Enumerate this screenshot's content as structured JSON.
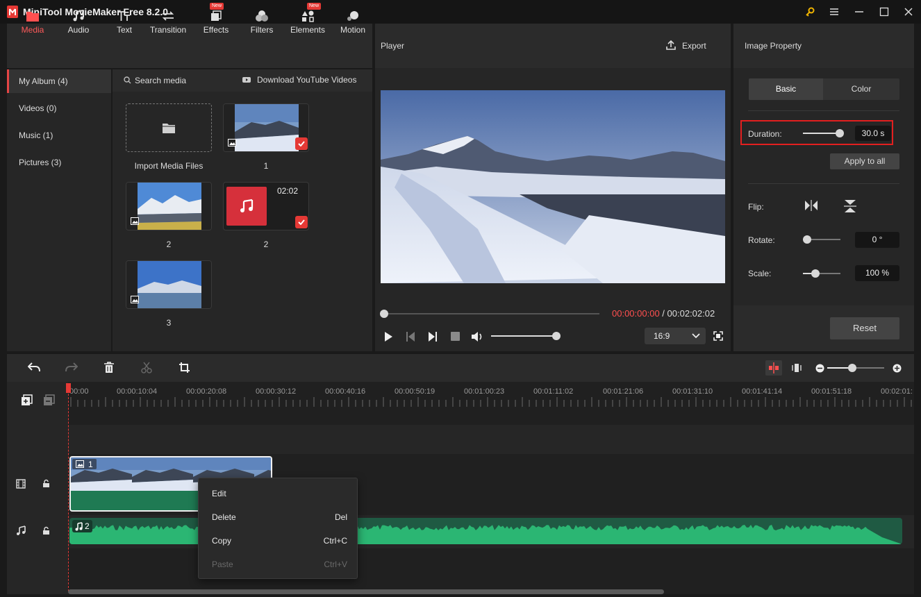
{
  "app": {
    "title": "MiniTool MovieMaker Free 8.2.0"
  },
  "toolbar": {
    "tabs": [
      {
        "label": "Media",
        "icon": "media-folder-icon",
        "active": true
      },
      {
        "label": "Audio",
        "icon": "music-note-icon"
      },
      {
        "label": "Text",
        "icon": "text-tt-icon"
      },
      {
        "label": "Transition",
        "icon": "transition-arrows-icon"
      },
      {
        "label": "Effects",
        "icon": "effects-icon",
        "badge": "New"
      },
      {
        "label": "Filters",
        "icon": "filters-icon"
      },
      {
        "label": "Elements",
        "icon": "elements-icon",
        "badge": "New"
      },
      {
        "label": "Motion",
        "icon": "motion-icon"
      }
    ]
  },
  "library": {
    "nav": [
      {
        "label": "My Album (4)",
        "active": true
      },
      {
        "label": "Videos (0)"
      },
      {
        "label": "Music (1)"
      },
      {
        "label": "Pictures (3)"
      }
    ],
    "search_label": "Search media",
    "download_label": "Download YouTube Videos",
    "items": [
      {
        "label": "Import Media Files"
      },
      {
        "label": "1"
      },
      {
        "label": "2"
      },
      {
        "label": "2",
        "duration": "02:02"
      },
      {
        "label": "3"
      }
    ]
  },
  "player": {
    "title": "Player",
    "export_label": "Export",
    "time_current": "00:00:00:00",
    "time_separator": " / ",
    "time_total": "00:02:02:02",
    "aspect_ratio": "16:9",
    "progress": 0,
    "volume": 1.0
  },
  "property": {
    "title": "Image Property",
    "tabs": [
      "Basic",
      "Color"
    ],
    "duration_label": "Duration:",
    "duration_value": "30.0 s",
    "apply_all_label": "Apply to all",
    "flip_label": "Flip:",
    "rotate_label": "Rotate:",
    "rotate_value": "0 °",
    "scale_label": "Scale:",
    "scale_value": "100 %",
    "reset_label": "Reset"
  },
  "timeline": {
    "ruler": [
      "00:00",
      "00:00:10:04",
      "00:00:20:08",
      "00:00:30:12",
      "00:00:40:16",
      "00:00:50:19",
      "00:01:00:23",
      "00:01:11:02",
      "00:01:21:06",
      "00:01:31:10",
      "00:01:41:14",
      "00:01:51:18",
      "00:02:01:"
    ],
    "video_clip_label": "1",
    "audio_clip_label": "2"
  },
  "context_menu": {
    "items": [
      {
        "label": "Edit",
        "shortcut": ""
      },
      {
        "label": "Delete",
        "shortcut": "Del"
      },
      {
        "label": "Copy",
        "shortcut": "Ctrl+C"
      },
      {
        "label": "Paste",
        "shortcut": "Ctrl+V",
        "disabled": true
      }
    ]
  },
  "colors": {
    "accent": "#e53935",
    "audio_wave": "#2bb673",
    "video_track": "#1f7a53"
  }
}
